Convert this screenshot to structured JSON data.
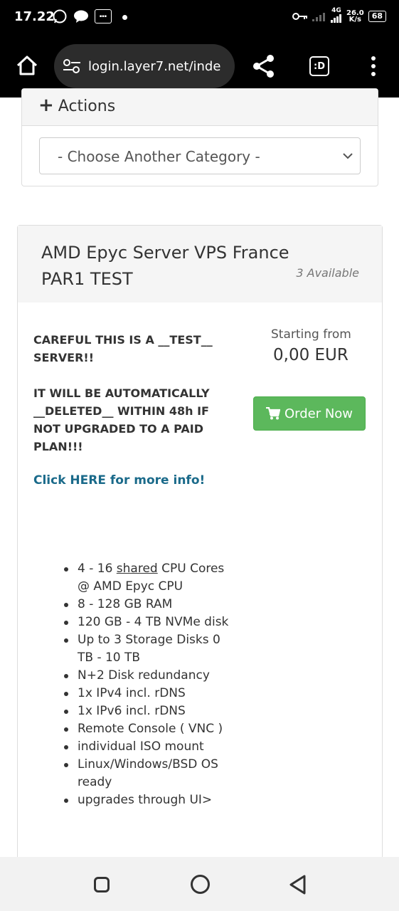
{
  "status_bar": {
    "time": "17.22",
    "network_type": "4G",
    "speed_value": "26.0",
    "speed_unit": "K/s",
    "battery": "68"
  },
  "browser": {
    "url": "login.layer7.net/inde",
    "tab_label": ":D"
  },
  "actions_panel": {
    "title": "Actions",
    "category_select": "- Choose Another Category -"
  },
  "product": {
    "name": "AMD Epyc Server VPS France PAR1 TEST",
    "availability": "3 Available",
    "description_lines": [
      "CAREFUL THIS IS A __TEST__ SERVER!!",
      "IT WILL BE AUTOMATICALLY __DELETED__ WITHIN 48h IF NOT UPGRADED TO A PAID PLAN!!!"
    ],
    "info_link": "Click HERE for more info!",
    "price_label": "Starting from",
    "price": "0,00 EUR",
    "order_button": "Order Now",
    "feature_1_pre": "4 - 16 ",
    "feature_1_underlined": "shared",
    "feature_1_post": " CPU Cores @ AMD Epyc CPU",
    "features": [
      "8 - 128 GB RAM",
      "120 GB - 4 TB NVMe disk",
      "Up to 3 Storage Disks 0 TB - 10 TB",
      "N+2 Disk redundancy",
      "1x IPv4 incl. rDNS",
      "1x IPv6 incl. rDNS",
      "Remote Console ( VNC )",
      "individual ISO mount",
      "Linux/Windows/BSD OS ready",
      "upgrades through UI>"
    ]
  },
  "colors": {
    "order_green": "#5cb85c",
    "link_blue": "#1a6a8a",
    "header_gray": "#f5f5f5"
  }
}
